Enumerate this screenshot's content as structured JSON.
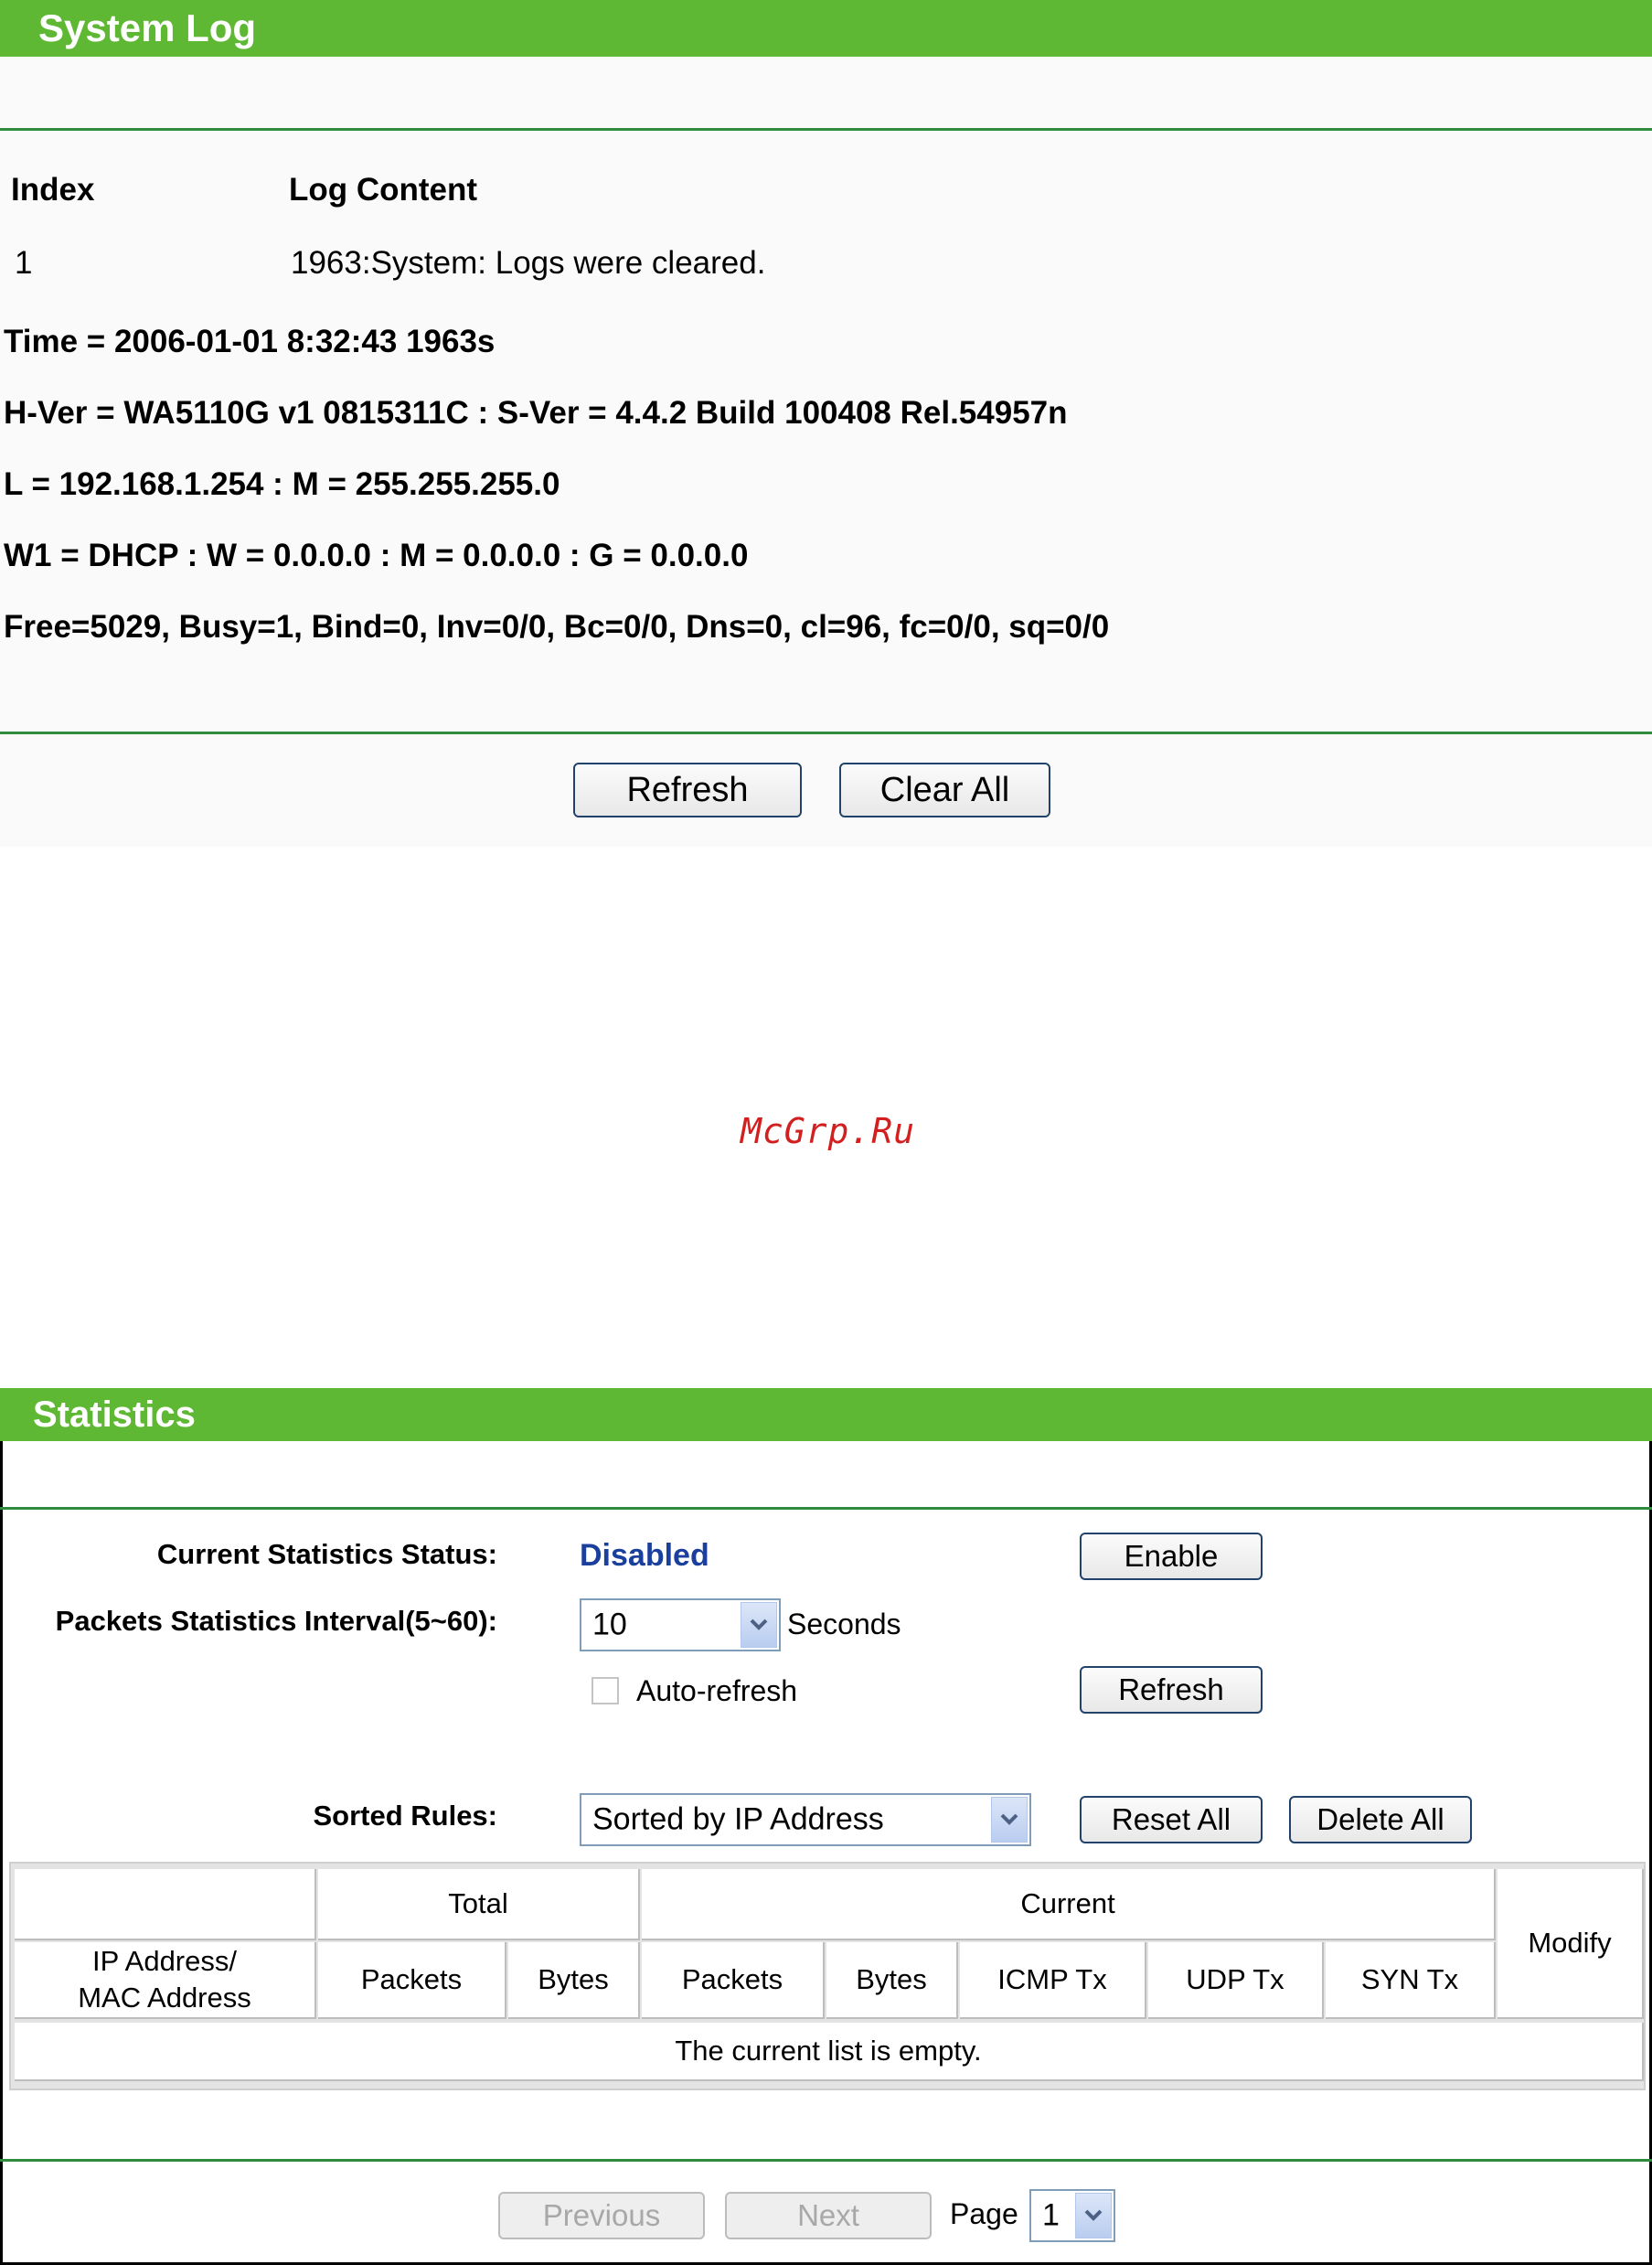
{
  "system_log": {
    "title": "System Log",
    "columns": {
      "index": "Index",
      "content": "Log Content"
    },
    "entries": [
      {
        "index": "1",
        "content": "1963:System: Logs were cleared."
      }
    ],
    "info_lines": [
      "Time = 2006-01-01 8:32:43 1963s",
      "H-Ver = WA5110G v1 0815311C : S-Ver = 4.4.2 Build 100408 Rel.54957n",
      "L = 192.168.1.254 : M = 255.255.255.0",
      "W1 = DHCP : W = 0.0.0.0 : M = 0.0.0.0 : G = 0.0.0.0",
      "Free=5029, Busy=1, Bind=0, Inv=0/0, Bc=0/0, Dns=0, cl=96, fc=0/0, sq=0/0"
    ],
    "buttons": {
      "refresh": "Refresh",
      "clear_all": "Clear All"
    }
  },
  "watermark": "McGrp.Ru",
  "statistics": {
    "title": "Statistics",
    "status_label": "Current Statistics Status:",
    "status_value": "Disabled",
    "enable_button": "Enable",
    "interval_label": "Packets Statistics Interval(5~60):",
    "interval_value": "10",
    "interval_unit": "Seconds",
    "auto_refresh_label": "Auto-refresh",
    "auto_refresh_checked": false,
    "refresh_button": "Refresh",
    "sorted_label": "Sorted Rules:",
    "sorted_value": "Sorted by IP Address",
    "reset_all_button": "Reset All",
    "delete_all_button": "Delete All",
    "table": {
      "group_total": "Total",
      "group_current": "Current",
      "modify": "Modify",
      "ip_mac_line1": "IP Address/",
      "ip_mac_line2": "MAC Address",
      "columns": [
        "Packets",
        "Bytes",
        "Packets",
        "Bytes",
        "ICMP Tx",
        "UDP Tx",
        "SYN Tx"
      ],
      "empty_message": "The current list is empty."
    },
    "pagination": {
      "previous": "Previous",
      "next": "Next",
      "page_label": "Page",
      "page_value": "1"
    }
  },
  "colors": {
    "header_green": "#5fb833",
    "rule_green": "#2e8b3f",
    "status_blue": "#1a3f9c",
    "watermark_red": "#d21f1f"
  },
  "icons": {
    "dropdown": "chevron-down-icon",
    "checkbox": "checkbox-icon"
  }
}
